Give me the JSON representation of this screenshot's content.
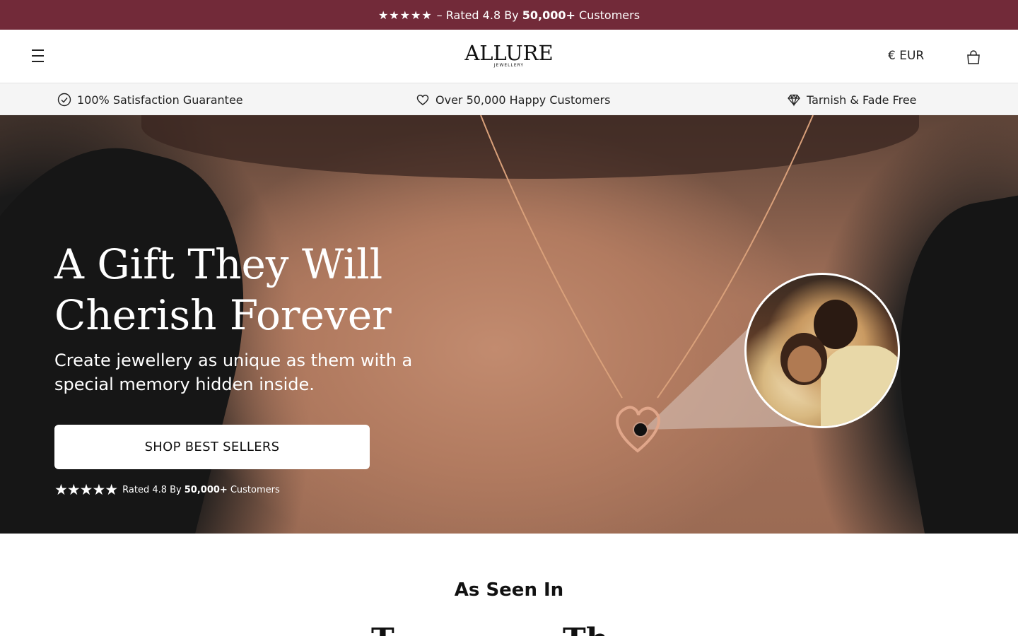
{
  "announcement": {
    "stars": "★★★★★",
    "text_before": "– Rated 4.8 By",
    "highlight": "50,000+",
    "text_after": "Customers"
  },
  "header": {
    "logo": "ALLURE",
    "logo_sub": "JEWELLERY",
    "currency": "€ EUR",
    "menu_icon": "hamburger-menu-icon",
    "cart_icon": "shopping-bag-icon"
  },
  "usp": [
    {
      "icon": "check-circle-icon",
      "label": "100% Satisfaction Guarantee"
    },
    {
      "icon": "heart-icon",
      "label": "Over 50,000 Happy Customers"
    },
    {
      "icon": "diamond-icon",
      "label": "Tarnish & Fade Free"
    }
  ],
  "hero": {
    "title_line1": "A Gift They Will",
    "title_line2": "Cherish Forever",
    "subtitle": "Create jewellery as unique as them with a special memory hidden inside.",
    "cta": "SHOP BEST SELLERS",
    "rating_stars": "★★★★★",
    "rating_text": "Rated 4.8 By",
    "rating_highlight": "50,000+",
    "rating_after": "Customers"
  },
  "seen_in": {
    "title": "As Seen In",
    "logos": [
      "T",
      "Th"
    ]
  },
  "colors": {
    "announcement_bg": "#722a39",
    "usp_bg": "#f5f5f5"
  }
}
